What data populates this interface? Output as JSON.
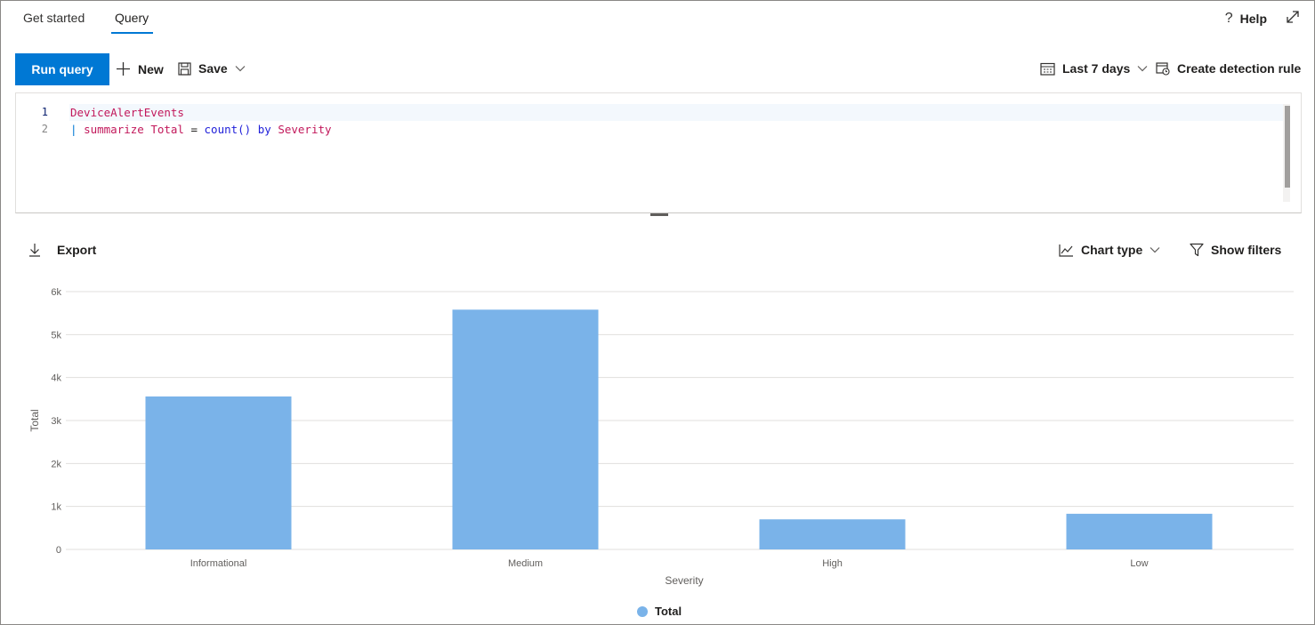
{
  "tabs": [
    {
      "label": "Get started"
    },
    {
      "label": "Query"
    }
  ],
  "header": {
    "help_label": "Help",
    "help_icon": "question-icon",
    "expand_icon": "expand-icon"
  },
  "toolbar": {
    "run_label": "Run query",
    "new_label": "New",
    "save_label": "Save",
    "time_range_label": "Last 7 days",
    "detection_label": "Create detection rule"
  },
  "editor": {
    "line_numbers": [
      "1",
      "2"
    ],
    "line1": "DeviceAlertEvents",
    "line2": {
      "pipe": "| ",
      "op": "summarize",
      "name": " Total",
      "eq": " = ",
      "func": "count()",
      "by": " by ",
      "col": "Severity"
    }
  },
  "results": {
    "export_label": "Export",
    "chart_type_label": "Chart type",
    "show_filters_label": "Show filters"
  },
  "colors": {
    "accent": "#0078d4",
    "bar": "#7ab3e9",
    "grid": "#e1dfdd"
  },
  "chart_data": {
    "type": "bar",
    "categories": [
      "Informational",
      "Medium",
      "High",
      "Low"
    ],
    "series": [
      {
        "name": "Total",
        "values": [
          3560,
          5580,
          700,
          830
        ]
      }
    ],
    "xlabel": "Severity",
    "ylabel": "Total",
    "yticks": [
      "0",
      "1k",
      "2k",
      "3k",
      "4k",
      "5k",
      "6k"
    ],
    "ylim": [
      0,
      6000
    ],
    "grid": true,
    "legend_position": "bottom"
  }
}
